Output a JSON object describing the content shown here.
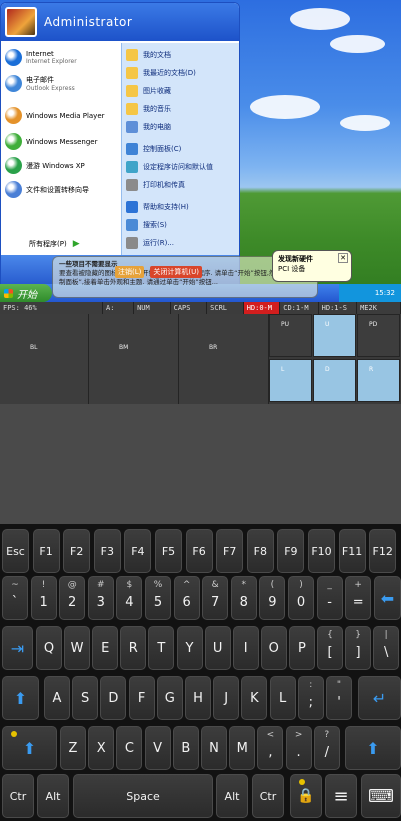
{
  "desktop": {
    "user": "Administrator",
    "left_items": [
      {
        "title": "Internet",
        "sub": "Internet Explorer",
        "color": "#1b6fd8"
      },
      {
        "title": "电子邮件",
        "sub": "Outlook Express",
        "color": "#3f86d8"
      },
      {
        "title": "Windows Media Player",
        "sub": "",
        "color": "#e4922a"
      },
      {
        "title": "Windows Messenger",
        "sub": "",
        "color": "#3fae3a"
      },
      {
        "title": "漫游 Windows XP",
        "sub": "",
        "color": "#2aa14a"
      },
      {
        "title": "文件和设置转移向导",
        "sub": "",
        "color": "#4a7fd6"
      }
    ],
    "all_programs": "所有程序(P)",
    "right_items": [
      "我的文档",
      "我最近的文档(D)",
      "图片收藏",
      "我的音乐",
      "我的电脑",
      "控制面板(C)",
      "设定程序访问和默认值",
      "打印机和传真",
      "帮助和支持(H)",
      "搜索(S)",
      "运行(R)..."
    ],
    "logoff": "注销(L)",
    "shutdown": "关闭计算机(U)",
    "start_label": "开始",
    "clock": "15:32",
    "balloon_title": "一些项目不需要显示",
    "balloon_text": "要查看被隐藏的图标... 单击“开始”菜单上的所有程序. 请单击“开始”按钮,然后单击“控制面板”,接着单击外观和主题. 请通过单击“开始”按钮...",
    "newhw_title": "发现新硬件",
    "newhw_text": "PCI 设备"
  },
  "status": {
    "fps": "FPS:  46%",
    "items": [
      "A:",
      "NUM",
      "CAPS",
      "SCRL",
      "HD:0-M",
      "CD:1-M",
      "HD:1-S",
      "ME2K"
    ]
  },
  "pad": {
    "buttons": [
      "BL",
      "BM",
      "BR"
    ],
    "dpad": [
      "PU",
      "U",
      "PD",
      "L",
      "D",
      "R"
    ]
  },
  "keyboard": {
    "row1": [
      "Esc",
      "F1",
      "F2",
      "F3",
      "F4",
      "F5",
      "F6",
      "F7",
      "F8",
      "F9",
      "F10",
      "F11",
      "F12"
    ],
    "row2": [
      [
        "`",
        "~"
      ],
      [
        "1",
        "!"
      ],
      [
        "2",
        "@"
      ],
      [
        "3",
        "#"
      ],
      [
        "4",
        "$"
      ],
      [
        "5",
        "%"
      ],
      [
        "6",
        "^"
      ],
      [
        "7",
        "&"
      ],
      [
        "8",
        "*"
      ],
      [
        "9",
        "("
      ],
      [
        "0",
        ")"
      ],
      [
        "-",
        "_"
      ],
      [
        "=",
        "+"
      ]
    ],
    "row3": [
      "Q",
      "W",
      "E",
      "R",
      "T",
      "Y",
      "U",
      "I",
      "O",
      "P",
      [
        "[",
        "{"
      ],
      [
        "]",
        "}"
      ],
      [
        "\\",
        "|"
      ]
    ],
    "row4": [
      "A",
      "S",
      "D",
      "F",
      "G",
      "H",
      "J",
      "K",
      "L",
      [
        ";",
        ":"
      ],
      [
        "'",
        "\""
      ]
    ],
    "row5": [
      "Z",
      "X",
      "C",
      "V",
      "B",
      "N",
      "M",
      [
        ",",
        "<"
      ],
      [
        ".",
        ">"
      ],
      [
        "/",
        "?"
      ]
    ],
    "ctrl": "Ctr",
    "alt": "Alt",
    "space": "Space"
  }
}
